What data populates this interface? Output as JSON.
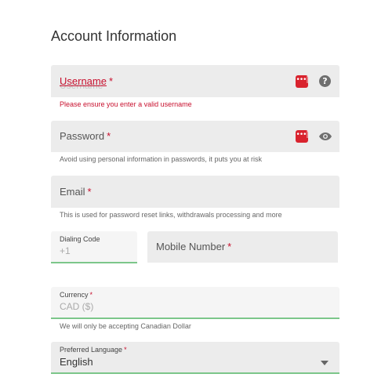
{
  "page": {
    "title": "Account Information"
  },
  "username": {
    "label": "Username",
    "required": "*",
    "placeholder_ghost": "Username",
    "error": "Please ensure you enter a valid username"
  },
  "password": {
    "label": "Password",
    "required": "*",
    "helper": "Avoid using personal information in passwords, it puts you at risk"
  },
  "email": {
    "label": "Email",
    "required": "*",
    "helper": "This is used for password reset links, withdrawals processing and more"
  },
  "dialing_code": {
    "label": "Dialing Code",
    "value": "+1"
  },
  "mobile": {
    "label": "Mobile Number",
    "required": "*"
  },
  "currency": {
    "label": "Currency",
    "required": "*",
    "value": "CAD ($)",
    "helper": "We will only be accepting Canadian Dollar"
  },
  "language": {
    "label": "Preferred Language",
    "required": "*",
    "value": "English"
  },
  "icons": {
    "password_manager": "password-manager-icon",
    "help": "help-icon",
    "show_password": "eye-icon",
    "dropdown": "caret-down-icon"
  },
  "colors": {
    "required": "#c8102e",
    "field_bg": "#ececec",
    "focus_underline": "#7cc68a",
    "password_manager_icon": "#d9232e"
  }
}
